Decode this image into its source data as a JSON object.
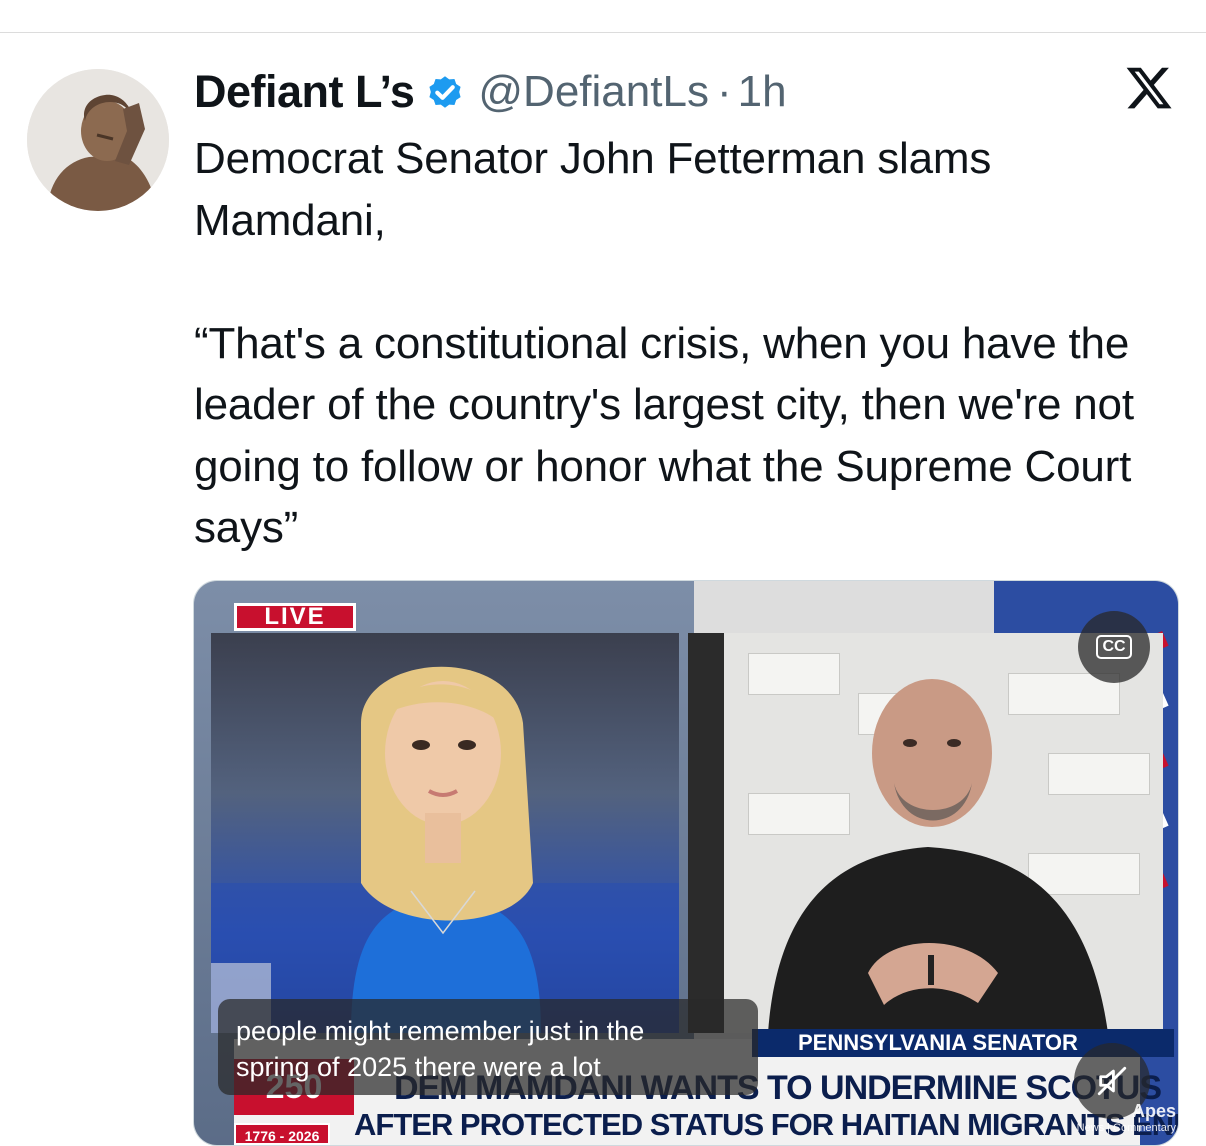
{
  "post": {
    "display_name": "Defiant L’s",
    "handle": "@DefiantLs",
    "separator": "·",
    "time": "1h",
    "text": "Democrat Senator John Fetterman slams Mamdani,\n\n“That's a constitutional crisis, when you have the leader of the country's largest city, then we're not going to follow or honor what the Supreme Court says”"
  },
  "icons": {
    "verified": "verified-badge-icon",
    "x_logo": "x-logo-icon",
    "cc": "closed-captions-icon",
    "mute": "muted-speaker-icon"
  },
  "video": {
    "live_label": "LIVE",
    "cc_label": "CC",
    "chyron_top": "PENNSYLVANIA SENATOR",
    "chyron_line1": "DEM MAMDANI WANTS TO UNDERMINE SCOTUS",
    "chyron_line2": "AFTER PROTECTED STATUS FOR HAITIAN MIGRANTS ENDS",
    "chyron_years": "1776 - 2026",
    "chyron_box": "250",
    "caption": "people might remember just in the\nspring of 2025 there were a lot",
    "watermark": "Apes",
    "watermark_sub": "News | Commentary"
  },
  "colors": {
    "verified_blue": "#1d9bf0",
    "handle_gray": "#536471",
    "live_red": "#c8102e",
    "chyron_navy": "#0b2a6b"
  }
}
